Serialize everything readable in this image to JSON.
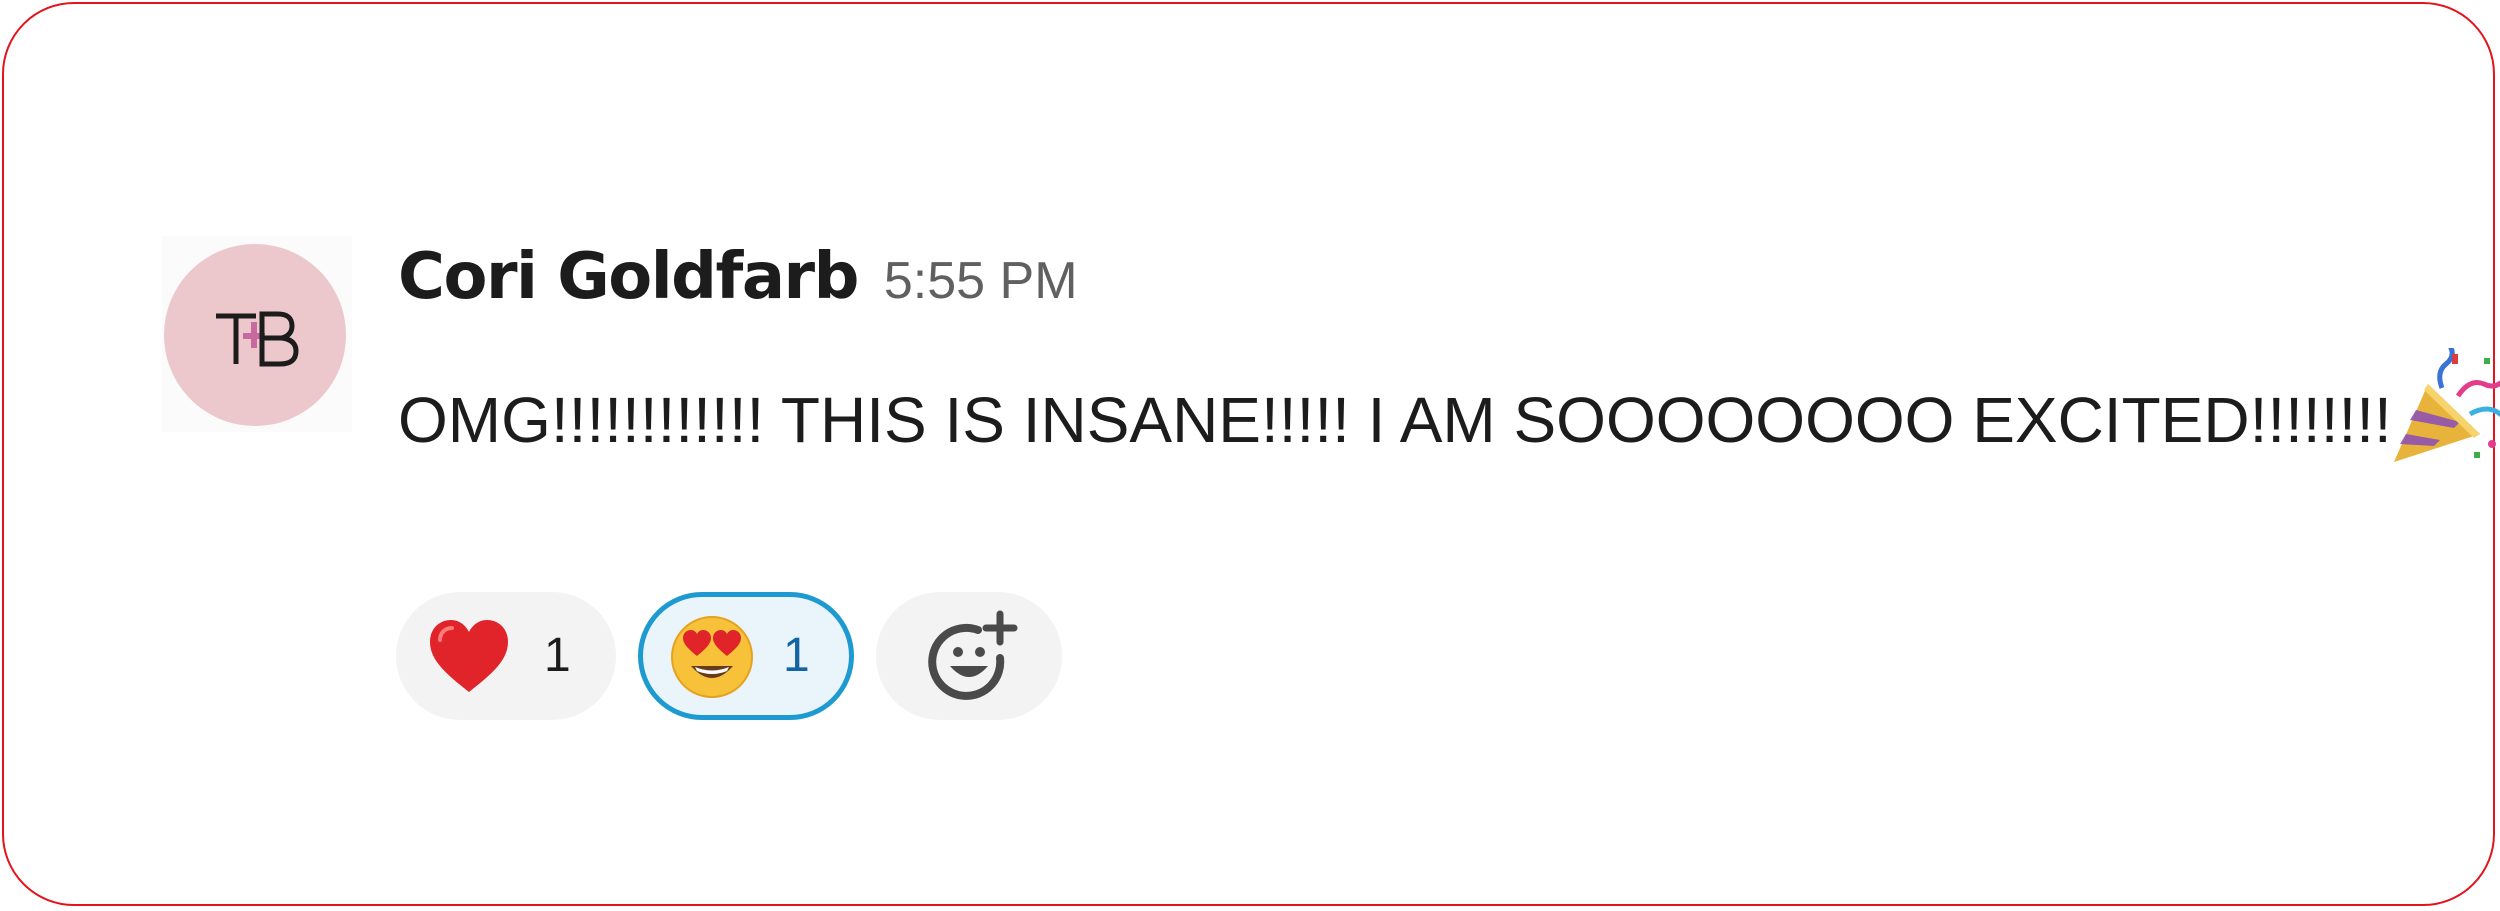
{
  "message": {
    "author": "Cori Goldfarb",
    "timestamp": "5:55 PM",
    "text": "OMG!!!!!!!!!!!! THIS IS INSANE!!!!! I AM SOOOOOOOO EXCITED!!!!!!!!",
    "trailing_emoji": "party-popper-icon",
    "avatar": {
      "initials": "TB",
      "background": "#ecc7cb",
      "accent": "#c76aa0"
    }
  },
  "reactions": [
    {
      "emoji": "red-heart-icon",
      "count": "1",
      "selected": false
    },
    {
      "emoji": "heart-eyes-face-icon",
      "count": "1",
      "selected": true
    }
  ],
  "add_reaction": {
    "icon": "add-reaction-icon"
  },
  "colors": {
    "frame_border": "#e3141b",
    "selected_border": "#1d9bd1",
    "selected_count": "#1264a3"
  }
}
